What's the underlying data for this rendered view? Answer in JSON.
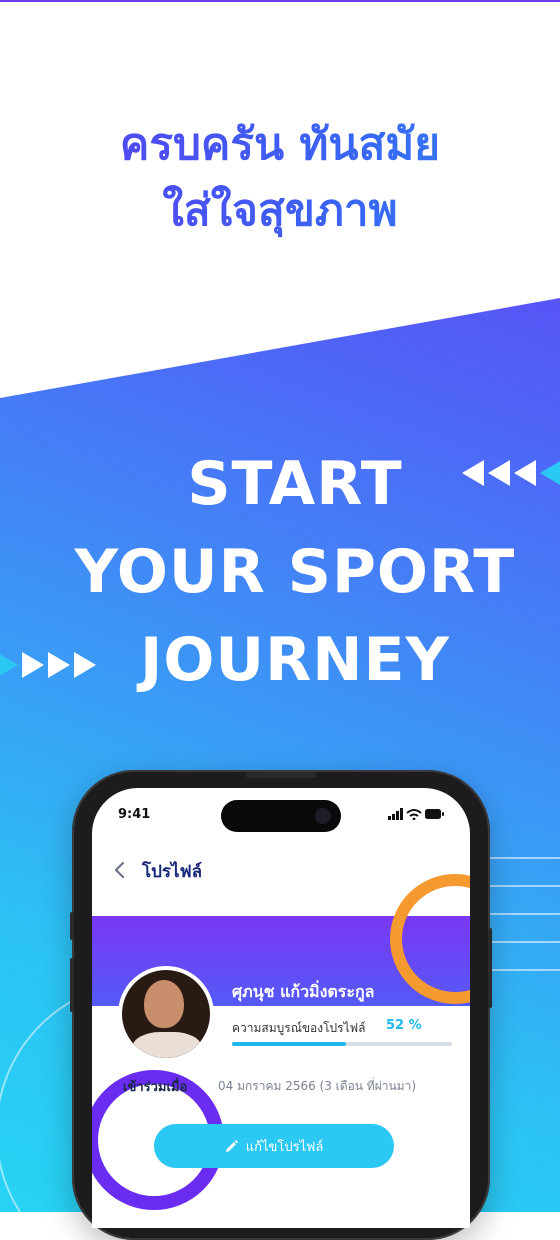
{
  "headline": {
    "line1": "ครบครัน ทันสมัย",
    "line2": "ใส่ใจสุขภาพ"
  },
  "hero": {
    "line1": "START",
    "line2": "YOUR SPORT",
    "line3": "JOURNEY"
  },
  "phone": {
    "status_time": "9:41",
    "nav": {
      "title": "โปรไฟล์",
      "back_icon": "chevron-left-icon"
    },
    "profile": {
      "name": "ศุภนุช แก้วมิ่งตระกูล",
      "completeness_label": "ความสมบูรณ์ของโปรไฟล์",
      "completeness_value": "52 %",
      "completeness_fraction": 0.52,
      "joined_label": "เข้าร่วมเมื่อ",
      "joined_value": "04 มกราคม 2566 (3 เดือน ที่ผ่านมา)",
      "edit_button_label": "แก้ไขโปรไฟล์"
    }
  },
  "colors": {
    "accent": "#2cc8f4",
    "purple": "#6b33f5",
    "orange": "#f59a2f",
    "nav_title": "#1a2a7a"
  }
}
